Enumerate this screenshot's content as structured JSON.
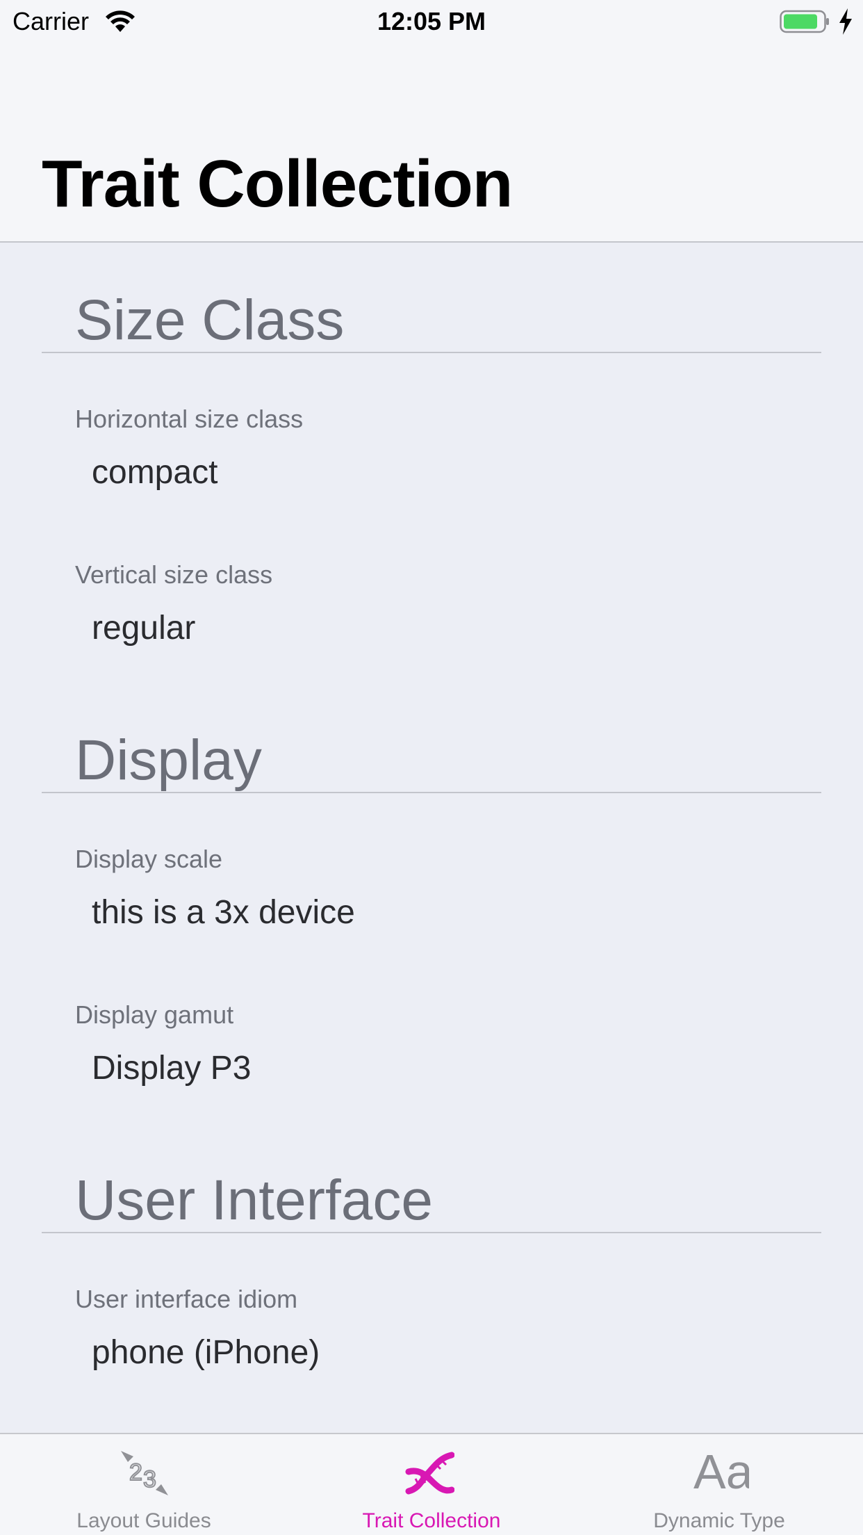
{
  "status_bar": {
    "carrier": "Carrier",
    "time": "12:05 PM",
    "battery_color": "#4cd964"
  },
  "nav": {
    "title": "Trait Collection"
  },
  "sections": [
    {
      "title": "Size Class",
      "items": [
        {
          "label": "Horizontal size class",
          "value": "compact"
        },
        {
          "label": "Vertical size class",
          "value": "regular"
        }
      ]
    },
    {
      "title": "Display",
      "items": [
        {
          "label": "Display scale",
          "value": "this is a 3x device"
        },
        {
          "label": "Display gamut",
          "value": "Display P3"
        }
      ]
    },
    {
      "title": "User Interface",
      "items": [
        {
          "label": "User interface idiom",
          "value": "phone (iPhone)"
        }
      ]
    }
  ],
  "tab_bar": {
    "accent_color": "#d818b3",
    "inactive_color": "#8a8b90",
    "tabs": [
      {
        "label": "Layout Guides",
        "icon": "layout-guides-icon",
        "active": false
      },
      {
        "label": "Trait Collection",
        "icon": "dna-icon",
        "active": true
      },
      {
        "label": "Dynamic Type",
        "icon": "text-size-icon",
        "glyph": "Aa",
        "active": false
      }
    ]
  }
}
